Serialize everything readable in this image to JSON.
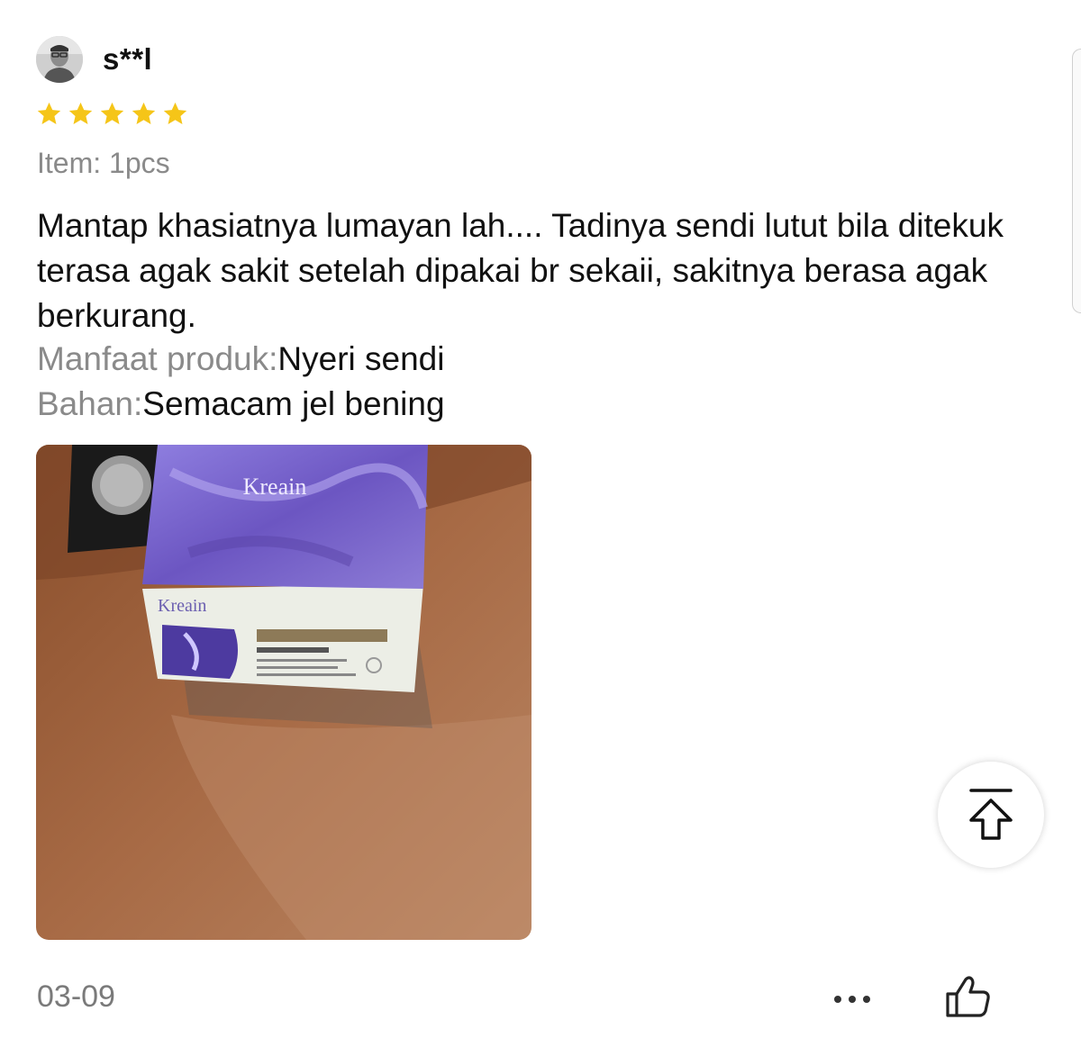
{
  "review": {
    "username": "s**l",
    "rating": 5,
    "item_label": "Item: 1pcs",
    "text": "Mantap khasiatnya lumayan lah.... Tadinya sendi lutut bila ditekuk terasa agak sakit setelah dipakai br sekaii, sakitnya berasa agak berkurang.",
    "attributes": [
      {
        "label": "Manfaat produk:",
        "value": "Nyeri sendi"
      },
      {
        "label": "Bahan:",
        "value": "Semacam jel bening"
      }
    ],
    "photo": {
      "brand_top": "Kreain",
      "brand_side": "Kreain"
    },
    "date": "03-09"
  },
  "icons": {
    "star": "star-icon",
    "more": "more-dots-icon",
    "like": "thumbs-up-icon",
    "back_to_top": "arrow-up-to-top-icon"
  },
  "colors": {
    "star": "#f5c518",
    "muted_text": "#8a8a8a",
    "body_text": "#111111",
    "box_purple": "#7d6bc7"
  }
}
